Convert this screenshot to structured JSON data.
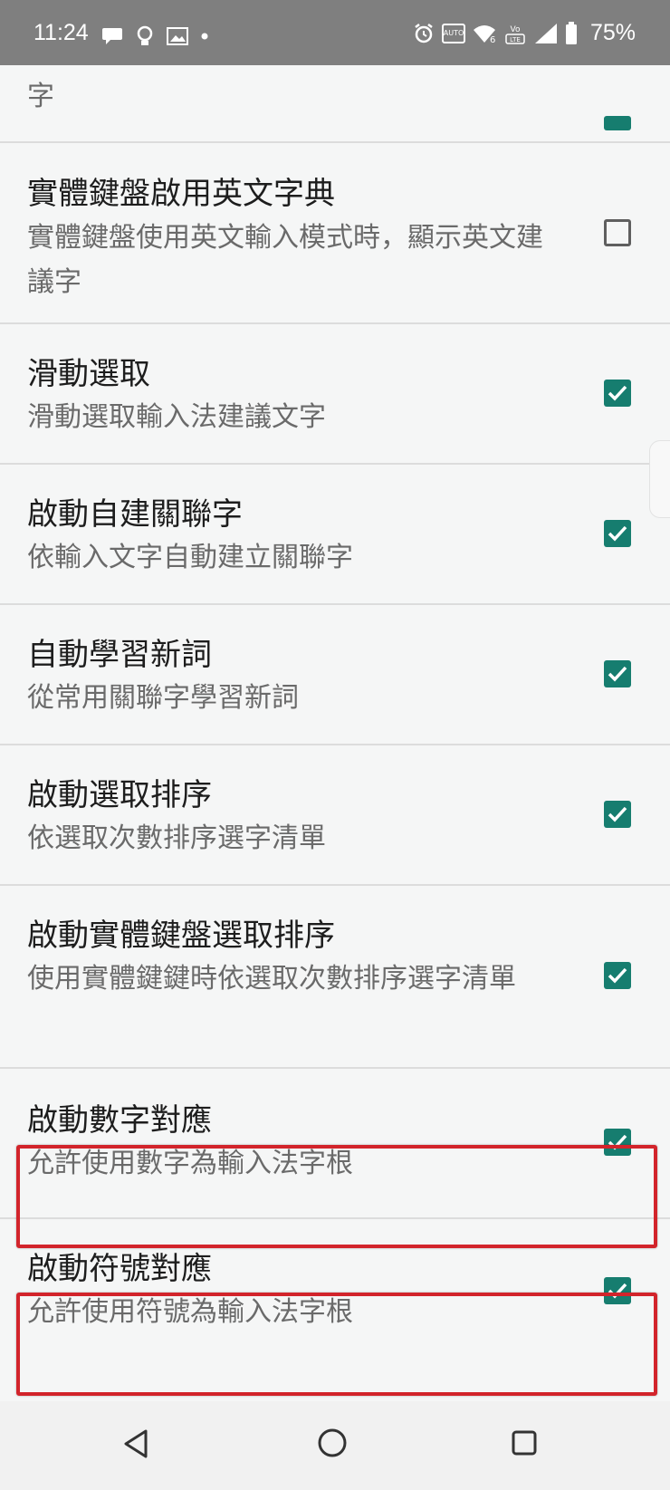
{
  "status_bar": {
    "time": "11:24",
    "battery": "75%",
    "left_icons": [
      "chat-bubble-icon",
      "lightbulb-icon",
      "image-icon",
      "dot-icon"
    ],
    "right_icons": [
      "alarm-icon",
      "auto-hd-icon",
      "wifi-6-icon",
      "volte-lte-icon",
      "cell-signal-icon",
      "battery-icon"
    ]
  },
  "settings": {
    "partial_top": {
      "sub_line2": "字",
      "checked": true
    },
    "items": [
      {
        "title": "實體鍵盤啟用英文字典",
        "subtitle": "實體鍵盤使用英文輸入模式時，顯示英文建議字",
        "checked": false
      },
      {
        "title": "滑動選取",
        "subtitle": "滑動選取輸入法建議文字",
        "checked": true
      },
      {
        "title": "啟動自建關聯字",
        "subtitle": "依輸入文字自動建立關聯字",
        "checked": true
      },
      {
        "title": "自動學習新詞",
        "subtitle": "從常用關聯字學習新詞",
        "checked": true
      },
      {
        "title": "啟動選取排序",
        "subtitle": "依選取次數排序選字清單",
        "checked": true
      },
      {
        "title": "啟動實體鍵盤選取排序",
        "subtitle": "使用實體鍵鍵時依選取次數排序選字清單",
        "checked": true
      },
      {
        "title": "啟動數字對應",
        "subtitle": "允許使用數字為輸入法字根",
        "checked": true,
        "highlighted": true
      },
      {
        "title": "啟動符號對應",
        "subtitle": "允許使用符號為輸入法字根",
        "checked": true,
        "highlighted": true
      }
    ]
  },
  "nav_bar": {
    "buttons": [
      "back-icon",
      "home-icon",
      "recents-icon"
    ]
  },
  "colors": {
    "checkbox_on": "#167d6f",
    "highlight_border": "#d2242b",
    "status_bar": "#7f7f7f"
  }
}
